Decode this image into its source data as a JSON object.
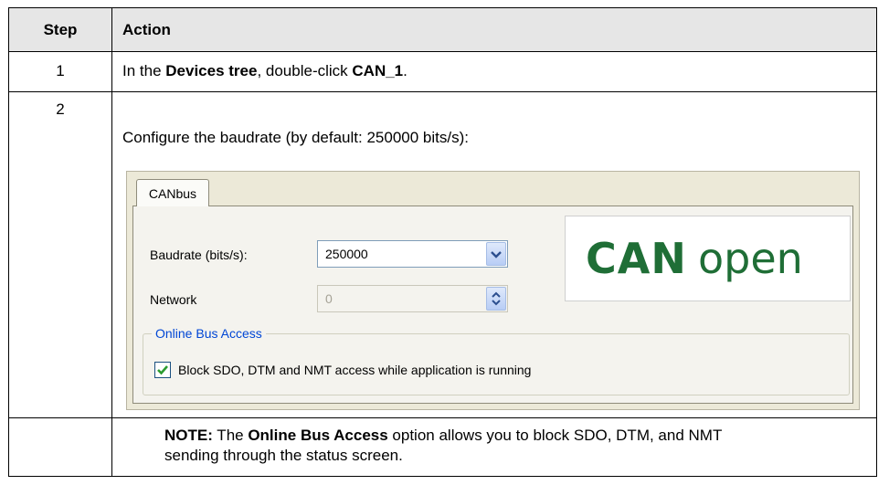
{
  "table": {
    "headers": {
      "step": "Step",
      "action": "Action"
    },
    "rows": [
      {
        "step": "1",
        "text_before": "In the ",
        "bold1": "Devices tree",
        "text_middle": ", double-click ",
        "bold2": "CAN_1",
        "text_after": "."
      },
      {
        "step": "2",
        "intro": "Configure the baudrate (by default: 250000 bits/s):"
      }
    ],
    "note": {
      "label": "NOTE:",
      "text_before": " The ",
      "bold": "Online Bus Access",
      "text_after": " option allows you to block SDO, DTM, and NMT",
      "line2": "sending through the status screen."
    }
  },
  "dialog": {
    "tab_label": "CANbus",
    "baudrate_label": "Baudrate (bits/s):",
    "baudrate_value": "250000",
    "network_label": "Network",
    "network_value": "0",
    "logo_bold": "CAN",
    "logo_light": "open",
    "group_title": "Online Bus Access",
    "checkbox_label": "Block SDO, DTM and NMT access while application is running",
    "checkbox_checked": true
  },
  "colors": {
    "header_bg": "#e6e6e6",
    "logo_green": "#1f6e36",
    "group_title_blue": "#0046d5",
    "check_green": "#2c9b2f"
  },
  "icons": {
    "select_arrow": "chevron-down-icon",
    "spinner": "up-down-arrows-icon",
    "checkmark": "checkmark-icon"
  }
}
